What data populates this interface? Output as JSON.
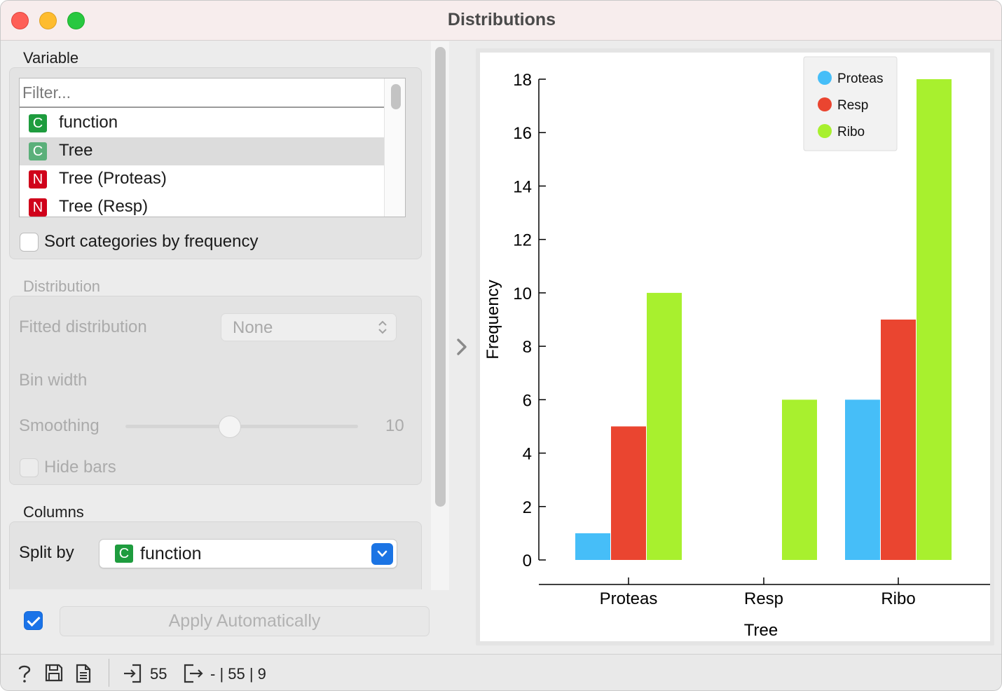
{
  "window": {
    "title": "Distributions"
  },
  "variable_section": {
    "label": "Variable",
    "filter_placeholder": "Filter...",
    "items": [
      {
        "type": "C",
        "label": "function",
        "selected": false
      },
      {
        "type": "C",
        "label": "Tree",
        "selected": true
      },
      {
        "type": "N",
        "label": "Tree (Proteas)",
        "selected": false
      },
      {
        "type": "N",
        "label": "Tree (Resp)",
        "selected": false
      }
    ],
    "sort_checkbox_label": "Sort categories by frequency",
    "sort_checked": false
  },
  "distribution_section": {
    "label": "Distribution",
    "fitted_label": "Fitted distribution",
    "fitted_value": "None",
    "bin_width_label": "Bin width",
    "smoothing_label": "Smoothing",
    "smoothing_value": "10",
    "smoothing_level": 0.45,
    "hide_bars_label": "Hide bars",
    "hide_bars_checked": false
  },
  "columns_section": {
    "label": "Columns",
    "split_by_label": "Split by",
    "split_by_type": "C",
    "split_by_value": "function"
  },
  "apply": {
    "checked": true,
    "label": "Apply Automatically"
  },
  "status": {
    "input_count": "55",
    "output_text": "- | 55 | 9"
  },
  "chart_data": {
    "type": "bar",
    "xlabel": "Tree",
    "ylabel": "Frequency",
    "categories": [
      "Proteas",
      "Resp",
      "Ribo"
    ],
    "series": [
      {
        "name": "Proteas",
        "color": "#46bef8",
        "values": [
          1,
          0,
          6
        ]
      },
      {
        "name": "Resp",
        "color": "#ea4530",
        "values": [
          5,
          0,
          9
        ]
      },
      {
        "name": "Ribo",
        "color": "#a8f02e",
        "values": [
          10,
          6,
          18
        ]
      }
    ],
    "ylim": [
      0,
      18
    ],
    "yticks": [
      0,
      2,
      4,
      6,
      8,
      10,
      12,
      14,
      16,
      18
    ],
    "legend_position": "top-right",
    "grid": false
  }
}
